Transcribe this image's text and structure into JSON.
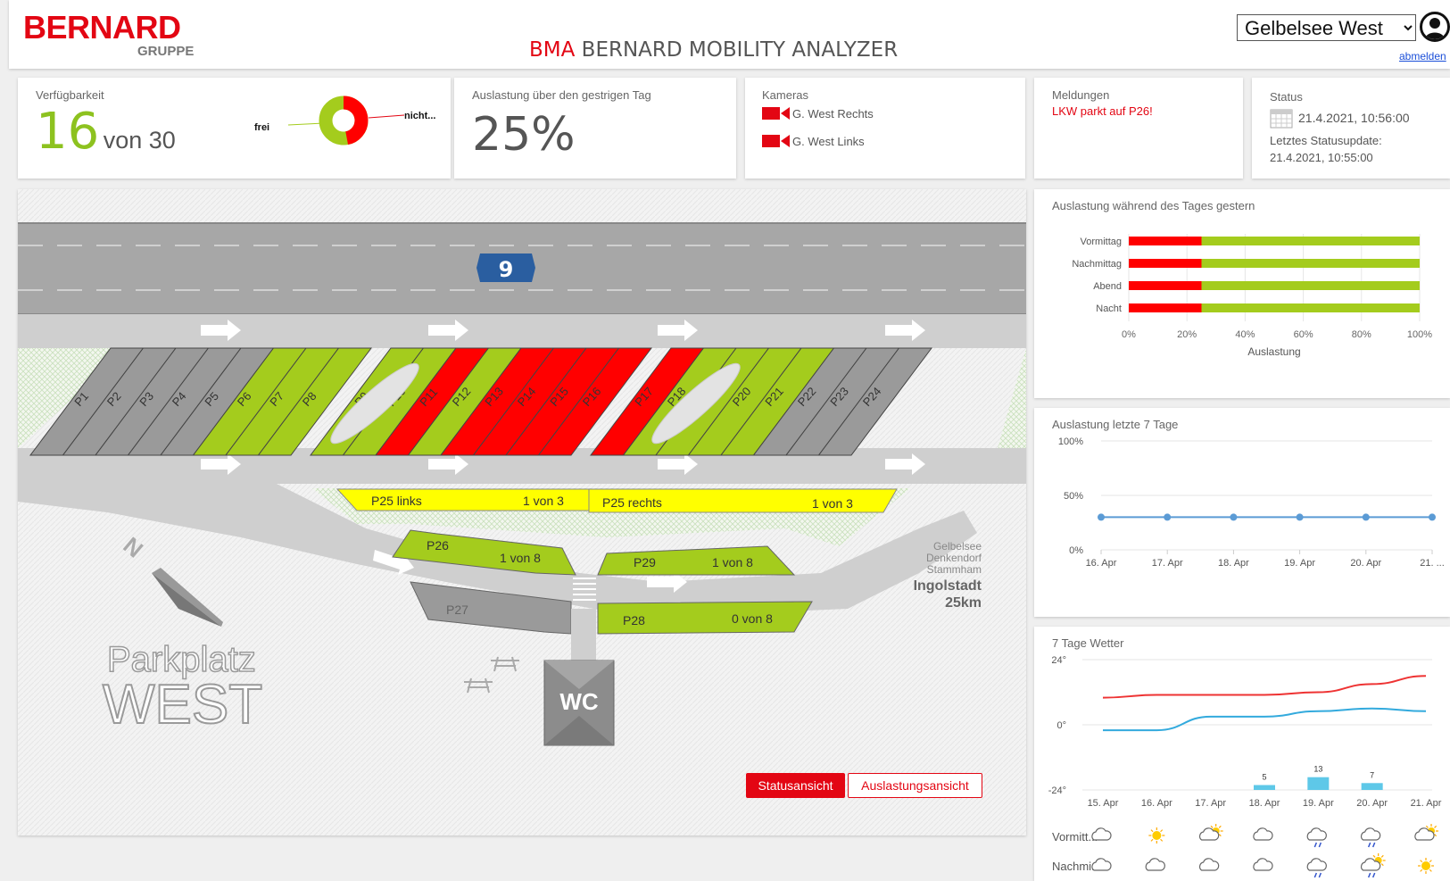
{
  "header": {
    "brand": "BERNARD",
    "brand_sub": "GRUPPE",
    "title_accent": "BMA",
    "title_rest": "BERNARD MOBILITY ANALYZER",
    "location": "Gelbelsee West",
    "logout": "abmelden"
  },
  "availability": {
    "label": "Verfügbarkeit",
    "free": "16",
    "of_total": "von 30",
    "legend_free": "frei",
    "legend_not": "nicht...",
    "free_fraction": 0.53
  },
  "utilization_yesterday": {
    "label": "Auslastung über den gestrigen Tag",
    "value": "25%"
  },
  "cameras": {
    "label": "Kameras",
    "items": [
      "G. West Rechts",
      "G. West Links"
    ]
  },
  "messages": {
    "label": "Meldungen",
    "items": [
      "LKW parkt auf P26!"
    ]
  },
  "status": {
    "label": "Status",
    "datetime": "21.4.2021, 10:56:00",
    "last_update_label": "Letztes Statusupdate:",
    "last_update": "21.4.2021, 10:55:00"
  },
  "map": {
    "road_number": "9",
    "spots": [
      {
        "label": "P1",
        "state": "grey"
      },
      {
        "label": "P2",
        "state": "grey"
      },
      {
        "label": "P3",
        "state": "grey"
      },
      {
        "label": "P4",
        "state": "grey"
      },
      {
        "label": "P5",
        "state": "grey"
      },
      {
        "label": "P6",
        "state": "green"
      },
      {
        "label": "P7",
        "state": "green"
      },
      {
        "label": "P8",
        "state": "green"
      },
      {
        "label": "P9",
        "state": "green"
      },
      {
        "label": "P10",
        "state": "green"
      },
      {
        "label": "P11",
        "state": "red"
      },
      {
        "label": "P12",
        "state": "green"
      },
      {
        "label": "P13",
        "state": "red"
      },
      {
        "label": "P14",
        "state": "red"
      },
      {
        "label": "P15",
        "state": "red"
      },
      {
        "label": "P16",
        "state": "red"
      },
      {
        "label": "P17",
        "state": "red"
      },
      {
        "label": "P18",
        "state": "green"
      },
      {
        "label": "P19",
        "state": "green"
      },
      {
        "label": "P20",
        "state": "green"
      },
      {
        "label": "P21",
        "state": "green"
      },
      {
        "label": "P22",
        "state": "grey"
      },
      {
        "label": "P23",
        "state": "grey"
      },
      {
        "label": "P24",
        "state": "grey"
      }
    ],
    "p25_left": "P25 links",
    "p25_left_count": "1 von 3",
    "p25_right": "P25 rechts",
    "p25_right_count": "1 von 3",
    "p26": "P26",
    "p26_count": "1 von 8",
    "p27": "P27",
    "p28": "P28",
    "p28_count": "0 von 8",
    "p29": "P29",
    "p29_count": "1 von 8",
    "wc": "WC",
    "north": "N",
    "dest": [
      "Gelbelsee",
      "Denkendorf",
      "Stammham"
    ],
    "dest_city": "Ingolstadt",
    "dest_km": "25km",
    "parkplatz": "Parkplatz",
    "west": "WEST",
    "btn_status": "Statusansicht",
    "btn_auslastung": "Auslastungsansicht"
  },
  "chart_daytime": {
    "title": "Auslastung während des Tages gestern",
    "xlabel": "Auslastung",
    "ticks": [
      "0%",
      "20%",
      "40%",
      "60%",
      "80%",
      "100%"
    ]
  },
  "chart_7days": {
    "title": "Auslastung letzte 7 Tage",
    "yticks": [
      "100%",
      "50%",
      "0%"
    ],
    "xticks": [
      "16. Apr",
      "17. Apr",
      "18. Apr",
      "19. Apr",
      "20. Apr",
      "21. ..."
    ]
  },
  "chart_weather": {
    "title": "7 Tage Wetter",
    "yticks": [
      "24°",
      "0°",
      "-24°"
    ],
    "xticks": [
      "15. Apr",
      "16. Apr",
      "17. Apr",
      "18. Apr",
      "19. Apr",
      "20. Apr",
      "21. Apr"
    ],
    "rain_labels": [
      "5",
      "13",
      "7"
    ],
    "row_vormittag": "Vormitt...",
    "row_nachmittag": "Nachmi...",
    "icons_vormittag": [
      "cloud",
      "sun",
      "cloud-sun",
      "cloud",
      "rain",
      "rain",
      "cloud-sun"
    ],
    "icons_nachmittag": [
      "cloud",
      "cloud",
      "cloud",
      "cloud",
      "rain",
      "rain-sun",
      "sun"
    ]
  },
  "chart_data": [
    {
      "type": "bar",
      "title": "Auslastung während des Tages gestern",
      "xlabel": "Auslastung",
      "categories": [
        "Vormittag",
        "Nachmittag",
        "Abend",
        "Nacht"
      ],
      "series": [
        {
          "values": [
            25,
            25,
            25,
            25
          ],
          "color": "#ff0000"
        },
        {
          "values": [
            75,
            75,
            75,
            75
          ],
          "color": "#a4cc1d"
        }
      ],
      "xlim": [
        0,
        100
      ]
    },
    {
      "type": "line",
      "title": "Auslastung letzte 7 Tage",
      "x": [
        "16. Apr",
        "17. Apr",
        "18. Apr",
        "19. Apr",
        "20. Apr",
        "21. Apr"
      ],
      "series": [
        {
          "values": [
            30,
            30,
            30,
            30,
            30,
            30
          ],
          "color": "#5b9bd5"
        }
      ],
      "ylim": [
        0,
        100
      ]
    },
    {
      "type": "line",
      "title": "7 Tage Wetter",
      "x": [
        "15. Apr",
        "16. Apr",
        "17. Apr",
        "18. Apr",
        "19. Apr",
        "20. Apr",
        "21. Apr"
      ],
      "series": [
        {
          "values": [
            10,
            11,
            11,
            11,
            12,
            15,
            18
          ],
          "color": "#ee3333"
        },
        {
          "values": [
            -2,
            -2,
            3,
            3,
            5,
            6,
            5
          ],
          "color": "#33aadd"
        }
      ],
      "rain": [
        0,
        0,
        0,
        5,
        13,
        7,
        0
      ],
      "ylim": [
        -24,
        24
      ]
    }
  ],
  "colors": {
    "accent": "#e30613",
    "green": "#a4cc1d",
    "red": "#ff0000",
    "grey": "#9a9a9a",
    "yellow": "#ffff00"
  }
}
